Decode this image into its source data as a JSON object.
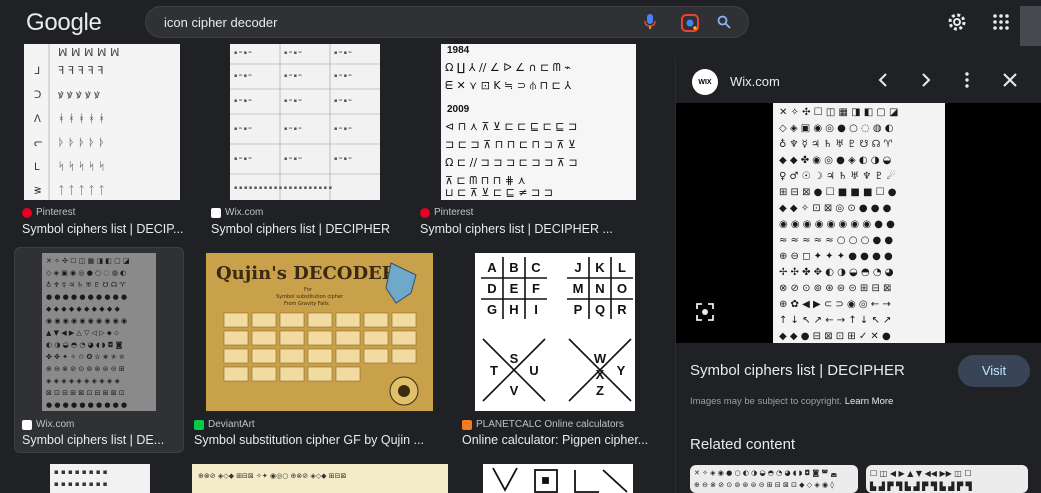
{
  "header": {
    "logo": "Google",
    "query": "icon cipher decoder"
  },
  "results": [
    {
      "source": "Pinterest",
      "title": "Symbol ciphers list | DECIP...",
      "favicon_color": "#e60023"
    },
    {
      "source": "Wix.com",
      "title": "Symbol ciphers list | DECIPHER",
      "favicon_color": "#ffffff"
    },
    {
      "source": "Pinterest",
      "title": "Symbol ciphers list | DECIPHER ...",
      "favicon_color": "#e60023"
    },
    {
      "source": "Wix.com",
      "title": "Symbol ciphers list | DE...",
      "favicon_color": "#ffffff"
    },
    {
      "source": "DeviantArt",
      "title": "Symbol substitution cipher GF by Qujin ...",
      "favicon_color": "#05cc47"
    },
    {
      "source": "PLANETCALC Online calculators",
      "title": "Online calculator: Pigpen cipher...",
      "favicon_color": "#f47b20"
    }
  ],
  "thumb_text": {
    "t3_year1": "1984",
    "t3_year2": "2009",
    "t5_title": "Qujin's DECODER",
    "t5_sub1": "For",
    "t5_sub2": "Symbol substitution cipher",
    "t5_sub3": "From Gravity Falls",
    "pigpen_grid": [
      "A",
      "B",
      "C",
      "D",
      "E",
      "F",
      "G",
      "H",
      "I"
    ],
    "pigpen_grid2": [
      "J",
      "K",
      "L",
      "M",
      "N",
      "O",
      "P",
      "Q",
      "R"
    ],
    "pigpen_x1": [
      "S",
      "T",
      "U",
      "V"
    ],
    "pigpen_x2": [
      "W",
      "X",
      "Y",
      "Z"
    ]
  },
  "panel": {
    "site": "Wix.com",
    "logo_text": "WIX",
    "title": "Symbol ciphers list | DECIPHER",
    "visit": "Visit",
    "copyright": "Images may be subject to copyright.",
    "learn_more": "Learn More",
    "related": "Related content"
  },
  "colors": {
    "background": "#202124",
    "search_bg": "#303134",
    "visit_bg": "#394457"
  }
}
